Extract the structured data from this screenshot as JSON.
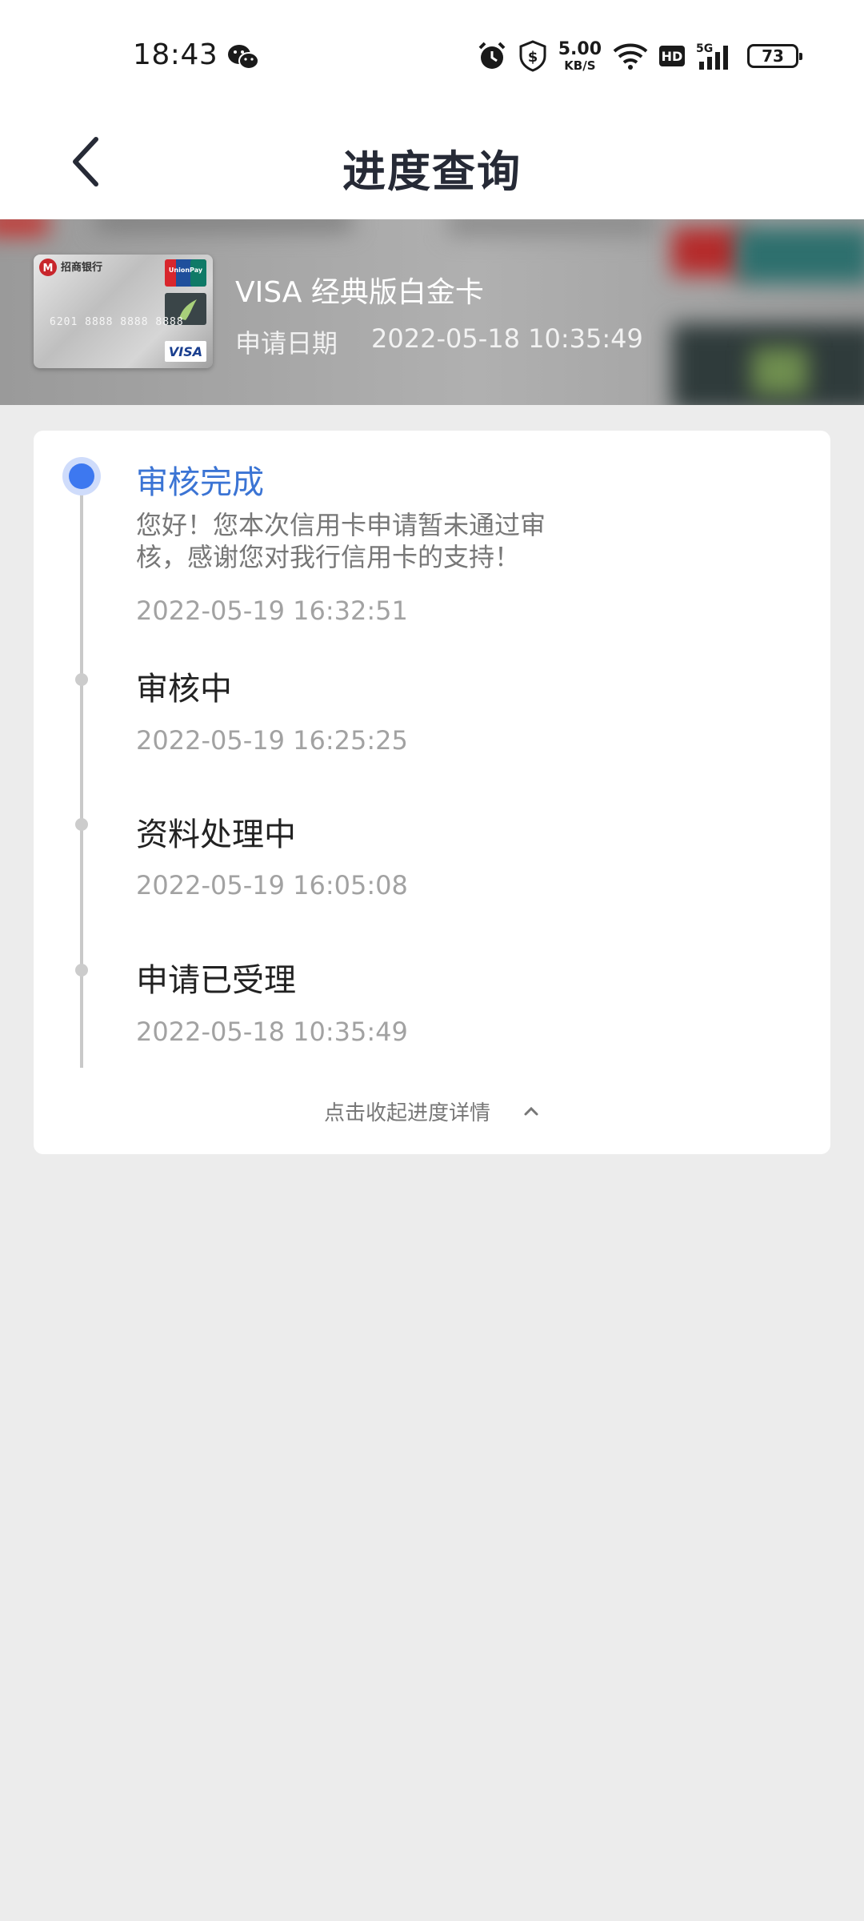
{
  "status_bar": {
    "time": "18:43",
    "net_speed_value": "5.00",
    "net_speed_unit": "KB/S",
    "hd_label": "HD",
    "signal_label": "5G",
    "battery_level": "73",
    "icons": [
      "wechat-icon",
      "alarm-icon",
      "shield-dollar-icon",
      "wifi-icon",
      "hd-icon",
      "signal-5g-icon",
      "battery-icon"
    ]
  },
  "header": {
    "title": "进度查询",
    "back_icon": "chevron-left-icon"
  },
  "card": {
    "name": "VISA 经典版白金卡",
    "date_label": "申请日期",
    "date_value": "2022-05-18 10:35:49",
    "thumb_labels": {
      "bank": "招商银行",
      "unionpay": "UnionPay",
      "visa": "VISA"
    }
  },
  "progress": {
    "steps": [
      {
        "title": "审核完成",
        "message": "您好！您本次信用卡申请暂未通过审核，感谢您对我行信用卡的支持！",
        "time": "2022-05-19 16:32:51",
        "status": "current"
      },
      {
        "title": "审核中",
        "time": "2022-05-19 16:25:25",
        "status": "done"
      },
      {
        "title": "资料处理中",
        "time": "2022-05-19 16:05:08",
        "status": "done"
      },
      {
        "title": "申请已受理",
        "time": "2022-05-18 10:35:49",
        "status": "done"
      }
    ],
    "collapse_label": "点击收起进度详情",
    "collapse_icon": "chevron-up-icon"
  },
  "colors": {
    "accent": "#3d78f0",
    "active_title": "#3b74d4",
    "background": "#ececec"
  }
}
